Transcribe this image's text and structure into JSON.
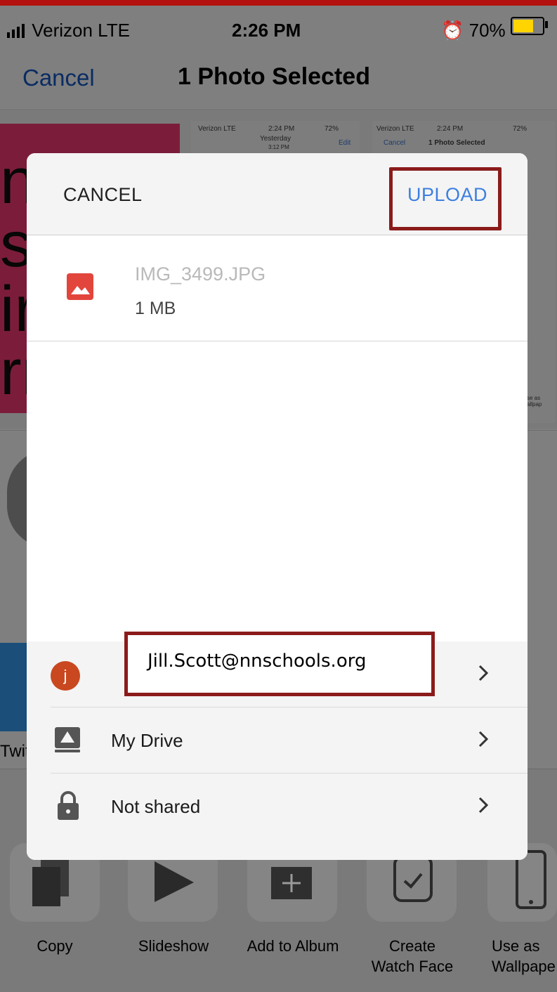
{
  "status_bar": {
    "carrier": "Verizon  LTE",
    "time": "2:26 PM",
    "battery": "70%"
  },
  "nav": {
    "cancel_label": "Cancel",
    "title": "1 Photo Selected"
  },
  "thumbnails": {
    "left_letters": [
      "n",
      "s",
      "ir",
      "rr"
    ],
    "mini_header": {
      "carrier": "Verizon  LTE",
      "time": "2:24 PM",
      "battery": "72%",
      "yesterday": "Yesterday",
      "yesterday_time": "3:12 PM",
      "edit": "Edit",
      "cancel": "Cancel",
      "title": "1 Photo Selected"
    },
    "mini_use_as": "se as\nallpap"
  },
  "share_apps": {
    "twitter_label": "Twit"
  },
  "actions": [
    {
      "label": "Copy"
    },
    {
      "label": "Slideshow"
    },
    {
      "label": "Add to Album"
    },
    {
      "label": "Create\nWatch Face"
    },
    {
      "label": "Use as\nWallpape"
    }
  ],
  "dialog": {
    "cancel_label": "CANCEL",
    "upload_label": "UPLOAD",
    "file": {
      "name": "IMG_3499.JPG",
      "size": "1 MB"
    },
    "account": {
      "initial": "j",
      "email": "Jill.Scott@nnschools.org"
    },
    "folder": {
      "label": "My Drive"
    },
    "sharing": {
      "label": "Not shared"
    }
  },
  "colors": {
    "accent": "#3c7fe0",
    "annotation": "#8b1b1b",
    "avatar": "#c9481f",
    "file_icon": "#e2453c"
  }
}
